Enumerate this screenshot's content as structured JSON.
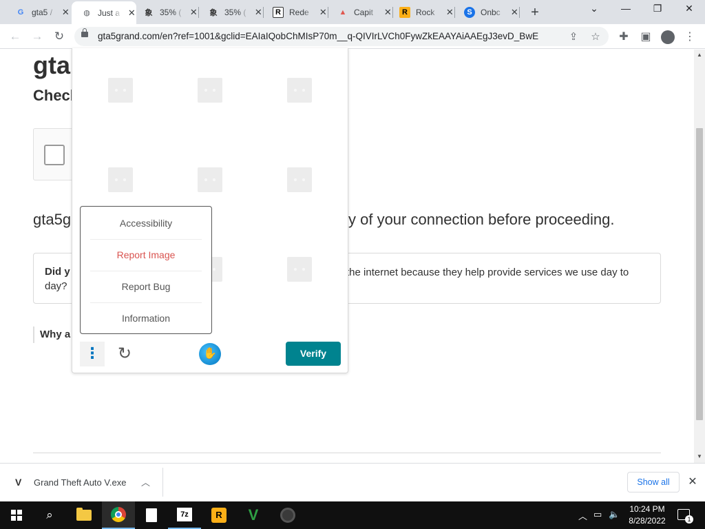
{
  "browser": {
    "tabs": [
      {
        "title": "gta5 /",
        "favicon": "google-icon",
        "fav_text": "G",
        "fav_color": "#4285f4"
      },
      {
        "title": "Just a",
        "favicon": "globe-icon",
        "fav_text": "◍",
        "fav_color": "#5f6368"
      },
      {
        "title": "35% (",
        "favicon": "translate-icon",
        "fav_text": "象",
        "fav_color": "#333333"
      },
      {
        "title": "35% (",
        "favicon": "translate-icon",
        "fav_text": "象",
        "fav_color": "#333333"
      },
      {
        "title": "Rede",
        "favicon": "rockstar-icon",
        "fav_text": "R",
        "fav_color": "#000000"
      },
      {
        "title": "Capit",
        "favicon": "capital-icon",
        "fav_text": "▲",
        "fav_color": "#e0574f"
      },
      {
        "title": "Rock",
        "favicon": "rockstar-icon",
        "fav_text": "R",
        "fav_color": "#fcaf17"
      },
      {
        "title": "Onbc",
        "favicon": "s-icon",
        "fav_text": "S",
        "fav_color": "#1a73e8"
      }
    ],
    "active_tab": 1,
    "new_tab": "+",
    "url": "gta5grand.com/en?ref=1001&gclid=EAIaIQobChMIsP70m__q-QIVIrLVCh0FywZkEAAYAiAAEgJ3evD_BwE"
  },
  "page": {
    "heading": "gta",
    "subheading": "Check",
    "paragraph_left": "gta5g",
    "paragraph_right": "y of your connection before proceeding.",
    "info_question": "Did y",
    "info_text_right": "the internet because they help provide services we use day to",
    "info_text_line2": "day?",
    "why_label": "Why a"
  },
  "captcha": {
    "menu_items": [
      {
        "label": "Accessibility",
        "style": "normal"
      },
      {
        "label": "Report Image",
        "style": "red"
      },
      {
        "label": "Report Bug",
        "style": "normal"
      },
      {
        "label": "Information",
        "style": "normal"
      }
    ],
    "verify_label": "Verify",
    "accent_color": "#00838f"
  },
  "downloads": {
    "file_name": "Grand Theft Auto V.exe",
    "show_all_label": "Show all"
  },
  "taskbar": {
    "time": "10:24 PM",
    "date": "8/28/2022",
    "notification_count": "1",
    "z7_label": "7z",
    "rstar_label": "R"
  }
}
